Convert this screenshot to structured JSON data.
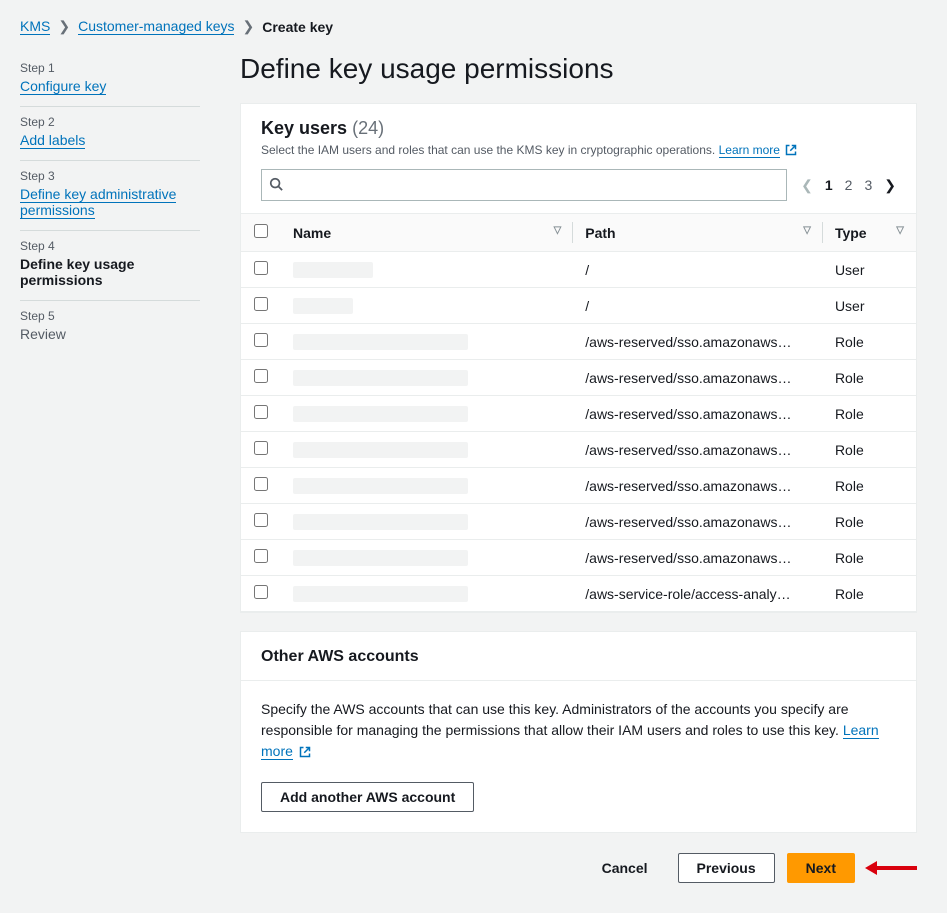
{
  "breadcrumb": {
    "items": [
      {
        "label": "KMS",
        "link": true
      },
      {
        "label": "Customer-managed keys",
        "link": true
      },
      {
        "label": "Create key",
        "link": false
      }
    ]
  },
  "sidebar": {
    "steps": [
      {
        "label": "Step 1",
        "title": "Configure key",
        "state": "link"
      },
      {
        "label": "Step 2",
        "title": "Add labels",
        "state": "link"
      },
      {
        "label": "Step 3",
        "title": "Define key administrative permissions",
        "state": "link"
      },
      {
        "label": "Step 4",
        "title": "Define key usage permissions",
        "state": "active"
      },
      {
        "label": "Step 5",
        "title": "Review",
        "state": "plain"
      }
    ]
  },
  "main": {
    "title": "Define key usage permissions",
    "keyUsers": {
      "heading": "Key users",
      "count": "(24)",
      "description": "Select the IAM users and roles that can use the KMS key in cryptographic operations.",
      "learnMore": "Learn more",
      "searchPlaceholder": "",
      "pagination": {
        "pages": [
          "1",
          "2",
          "3"
        ],
        "current": 0
      },
      "columns": {
        "name": "Name",
        "path": "Path",
        "type": "Type"
      },
      "rows": [
        {
          "nameRedacted": "w1",
          "path": "/",
          "type": "User"
        },
        {
          "nameRedacted": "w2",
          "path": "/",
          "type": "User"
        },
        {
          "nameRedacted": "w3",
          "path": "/aws-reserved/sso.amazonaws…",
          "type": "Role"
        },
        {
          "nameRedacted": "w3",
          "path": "/aws-reserved/sso.amazonaws…",
          "type": "Role"
        },
        {
          "nameRedacted": "w3",
          "path": "/aws-reserved/sso.amazonaws…",
          "type": "Role"
        },
        {
          "nameRedacted": "w3",
          "path": "/aws-reserved/sso.amazonaws…",
          "type": "Role"
        },
        {
          "nameRedacted": "w3",
          "path": "/aws-reserved/sso.amazonaws…",
          "type": "Role"
        },
        {
          "nameRedacted": "w3",
          "path": "/aws-reserved/sso.amazonaws…",
          "type": "Role"
        },
        {
          "nameRedacted": "w3",
          "path": "/aws-reserved/sso.amazonaws…",
          "type": "Role"
        },
        {
          "nameRedacted": "w3",
          "path": "/aws-service-role/access-analy…",
          "type": "Role"
        }
      ]
    },
    "otherAccounts": {
      "heading": "Other AWS accounts",
      "description": "Specify the AWS accounts that can use this key. Administrators of the accounts you specify are responsible for managing the permissions that allow their IAM users and roles to use this key.",
      "learnMore": "Learn more",
      "addButton": "Add another AWS account"
    },
    "footer": {
      "cancel": "Cancel",
      "previous": "Previous",
      "next": "Next"
    }
  }
}
